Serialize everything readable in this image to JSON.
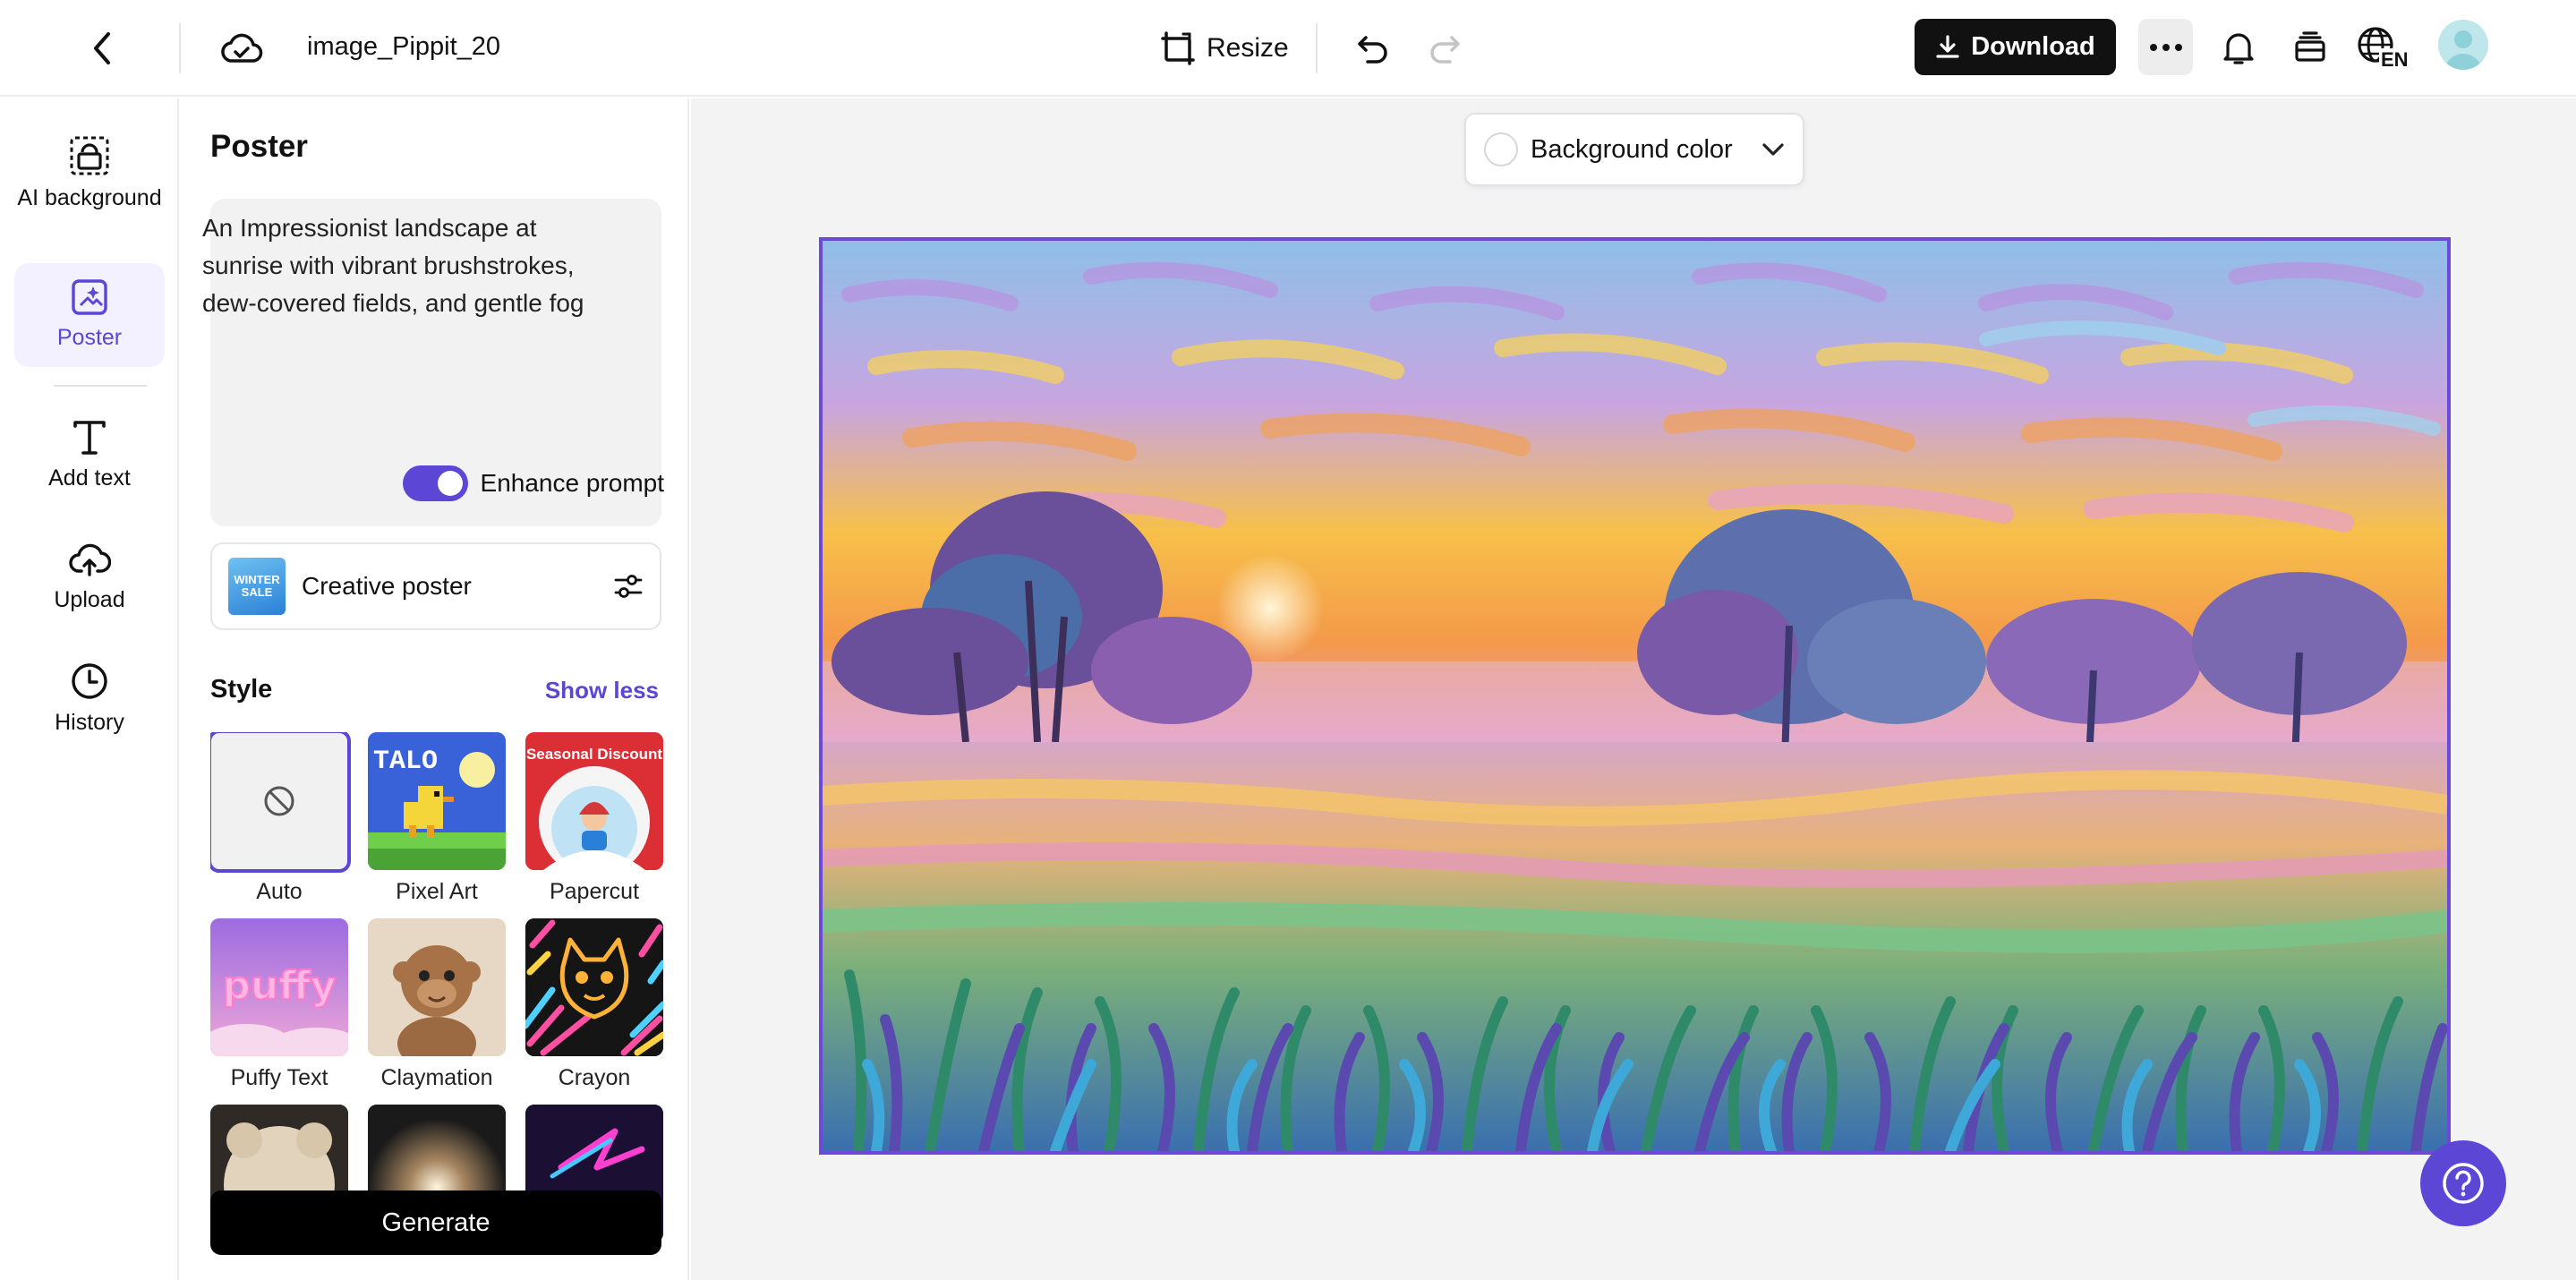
{
  "topbar": {
    "file_name": "image_Pippit_20",
    "resize_label": "Resize",
    "download_label": "Download",
    "language": "EN"
  },
  "rail": {
    "items": [
      {
        "label": "AI background",
        "icon": "ai-background-icon"
      },
      {
        "label": "Poster",
        "icon": "poster-icon",
        "active": true
      },
      {
        "label": "Add text",
        "icon": "text-icon"
      },
      {
        "label": "Upload",
        "icon": "upload-cloud-icon"
      },
      {
        "label": "History",
        "icon": "clock-icon"
      }
    ]
  },
  "panel": {
    "title": "Poster",
    "prompt": "An Impressionist landscape at sunrise with vibrant brushstrokes, dew-covered fields, and gentle fog",
    "enhance_label": "Enhance prompt",
    "enhance_on": true,
    "template": {
      "label": "Creative poster",
      "thumb_text": "WINTER SALE"
    },
    "style_title": "Style",
    "show_less": "Show less",
    "styles": [
      {
        "label": "Auto",
        "selected": true
      },
      {
        "label": "Pixel Art",
        "thumb_text": "TALO"
      },
      {
        "label": "Papercut",
        "thumb_text": "Seasonal Discount"
      },
      {
        "label": "Puffy Text",
        "thumb_text": "puffy"
      },
      {
        "label": "Claymation"
      },
      {
        "label": "Crayon"
      }
    ],
    "generate_label": "Generate"
  },
  "canvas": {
    "background_color_label": "Background color"
  },
  "colors": {
    "accent": "#5b46d6",
    "dark": "#111111",
    "canvas_bg": "#f3f3f4"
  }
}
